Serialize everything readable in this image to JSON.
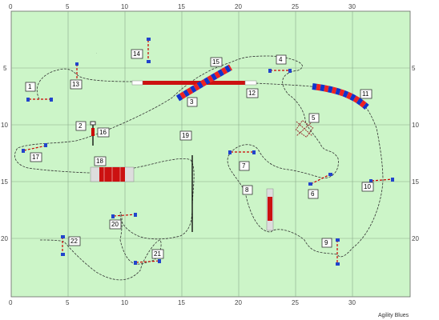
{
  "course": {
    "background_color": "#ccf5c8",
    "grid_color": "#8aaa8a",
    "x_ticks": [
      "0",
      "5",
      "10",
      "15",
      "20",
      "25",
      "30"
    ],
    "y_ticks": [
      "5",
      "10",
      "15",
      "20"
    ],
    "brand": "Agility Blues"
  },
  "obstacle_numbers": [
    "1",
    "2",
    "3",
    "4",
    "5",
    "6",
    "7",
    "8",
    "9",
    "10",
    "11",
    "12",
    "13",
    "14",
    "15",
    "16",
    "17",
    "18",
    "19",
    "20",
    "21",
    "22"
  ],
  "obstacles": [
    {
      "id": "jump-1",
      "kind": "jump",
      "label": "1"
    },
    {
      "id": "weave-2",
      "kind": "weave",
      "label": "2"
    },
    {
      "id": "tunnel-3",
      "kind": "tunnel",
      "label": "3"
    },
    {
      "id": "jump-4",
      "kind": "jump",
      "label": "4"
    },
    {
      "id": "tire-5",
      "kind": "tire",
      "label": "5"
    },
    {
      "id": "jump-6",
      "kind": "jump",
      "label": "6"
    },
    {
      "id": "jump-7",
      "kind": "jump",
      "label": "7"
    },
    {
      "id": "table-8",
      "kind": "table",
      "label": "8"
    },
    {
      "id": "jump-9",
      "kind": "jump",
      "label": "9"
    },
    {
      "id": "jump-10",
      "kind": "jump",
      "label": "10"
    },
    {
      "id": "tunnel-11",
      "kind": "tunnel",
      "label": "11"
    },
    {
      "id": "dogwalk-12",
      "kind": "dogwalk",
      "label": "12"
    },
    {
      "id": "jump-13",
      "kind": "jump",
      "label": "13"
    },
    {
      "id": "jump-14",
      "kind": "jump",
      "label": "14"
    },
    {
      "id": "tunnel-15",
      "kind": "tunnel",
      "label": "15"
    },
    {
      "id": "weave-16",
      "kind": "weave",
      "label": "16"
    },
    {
      "id": "jump-17",
      "kind": "jump",
      "label": "17"
    },
    {
      "id": "aframe-18",
      "kind": "aframe",
      "label": "18"
    },
    {
      "id": "weave-19",
      "kind": "weave",
      "label": "19"
    },
    {
      "id": "jump-20",
      "kind": "jump",
      "label": "20"
    },
    {
      "id": "jump-21",
      "kind": "jump",
      "label": "21"
    },
    {
      "id": "jump-22",
      "kind": "jump",
      "label": "22"
    }
  ]
}
